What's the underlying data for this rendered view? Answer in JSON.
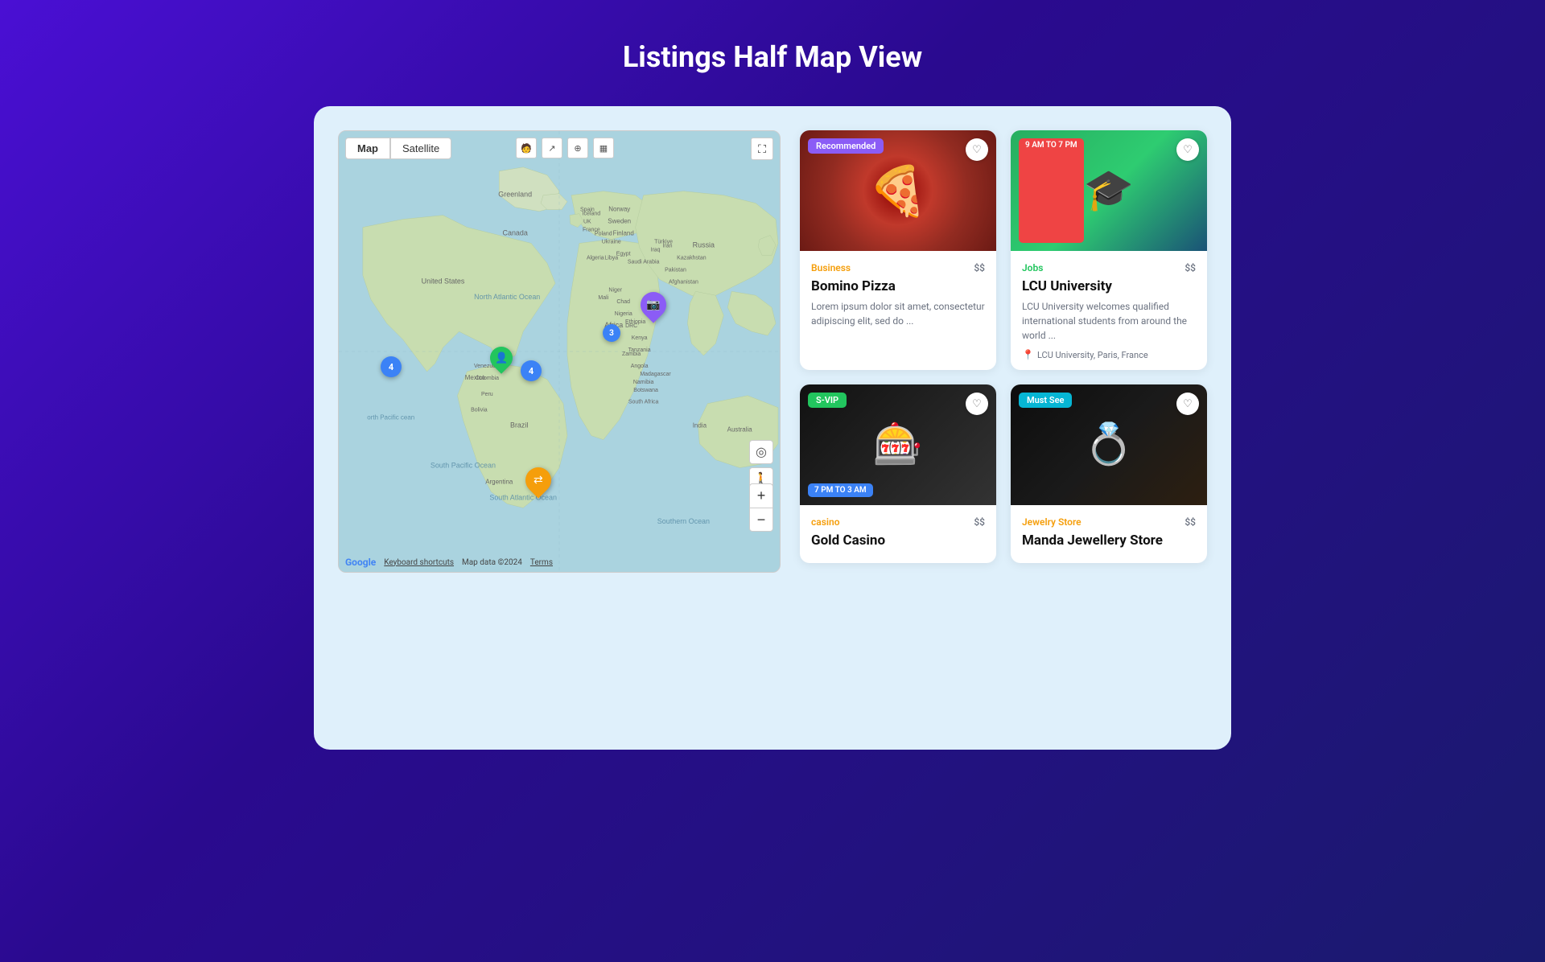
{
  "header": {
    "title": "Listings Half Map View"
  },
  "map": {
    "tab_map": "Map",
    "tab_satellite": "Satellite",
    "footer_shortcuts": "Keyboard shortcuts",
    "footer_data": "Map data ©2024",
    "footer_terms": "Terms",
    "google_label": "Google",
    "zoom_in": "+",
    "zoom_out": "−"
  },
  "listings": [
    {
      "id": "bomino-pizza",
      "badge": "Recommended",
      "badge_type": "recommended",
      "time_badge": null,
      "category": "Business",
      "category_class": "cat-business",
      "price": "$$",
      "title": "Bomino Pizza",
      "description": "Lorem ipsum dolor sit amet, consectetur adipiscing elit, sed do ...",
      "location": null,
      "image_type": "pizza"
    },
    {
      "id": "lcu-university",
      "badge": "9 AM TO 7 PM",
      "badge_type": "time-red",
      "time_badge": null,
      "category": "Jobs",
      "category_class": "cat-jobs",
      "price": "$$",
      "title": "LCU University",
      "description": "LCU University welcomes qualified international students from around the world ...",
      "location": "LCU University, Paris, France",
      "image_type": "graduation"
    },
    {
      "id": "gold-casino",
      "badge": "S-VIP",
      "badge_type": "svip",
      "time_badge": "7 PM TO 3 AM",
      "category": "casino",
      "category_class": "cat-casino",
      "price": "$$",
      "title": "Gold Casino",
      "description": null,
      "location": null,
      "image_type": "casino"
    },
    {
      "id": "manda-jewellery",
      "badge": "Must See",
      "badge_type": "mustsee",
      "time_badge": null,
      "category": "Jewelry Store",
      "category_class": "cat-jewelry",
      "price": "$$",
      "title": "Manda Jewellery Store",
      "description": null,
      "location": null,
      "image_type": "jewelry"
    }
  ]
}
